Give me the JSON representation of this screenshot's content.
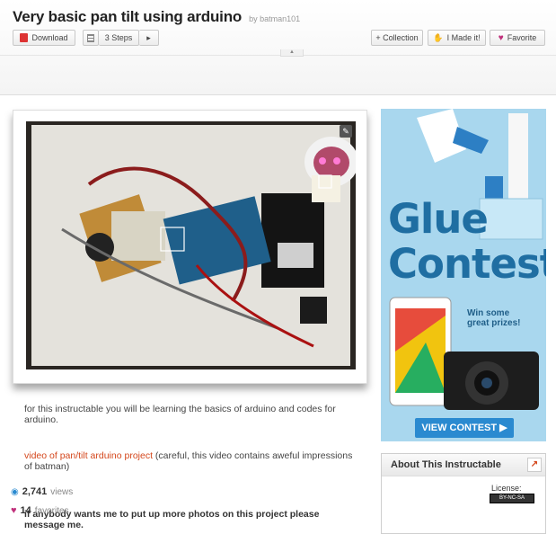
{
  "header": {
    "title": "Very basic pan tilt using arduino",
    "byline": "by batman101",
    "download_label": "Download",
    "steps_label": "3 Steps",
    "next_label": "▸",
    "collection_label": "+ Collection",
    "imade_label": "I Made it!",
    "favorite_label": "Favorite",
    "collapse_label": "▲"
  },
  "main": {
    "intro": "for this instructable you will be learning the basics of arduino and codes for arduino.",
    "video_link": "video of pan/tilt arduino project",
    "video_note": " (careful, this video contains aweful impressions of batman)",
    "closing": "if anybody wants me to put up more photos on this project please message me."
  },
  "ad": {
    "title_line1": "Glue",
    "title_line2": "Contest",
    "win_line1": "Win some",
    "win_line2": "great prizes!",
    "cta": "VIEW CONTEST ▶",
    "accent": "#1f6ea2",
    "background": "#a9d7ee"
  },
  "about": {
    "heading": "About This Instructable",
    "views_count": "2,741",
    "views_label": "views",
    "favorites_count": "14",
    "favorites_label": "favorites",
    "license_label": "License:",
    "license_badge": "BY-NC-SA"
  },
  "icons": {
    "download": "pdf-icon",
    "steps": "list-icon",
    "made": "hand-icon",
    "favorite": "heart-icon",
    "views": "eye-icon",
    "favorites": "heart-icon",
    "stats": "chart-icon"
  }
}
